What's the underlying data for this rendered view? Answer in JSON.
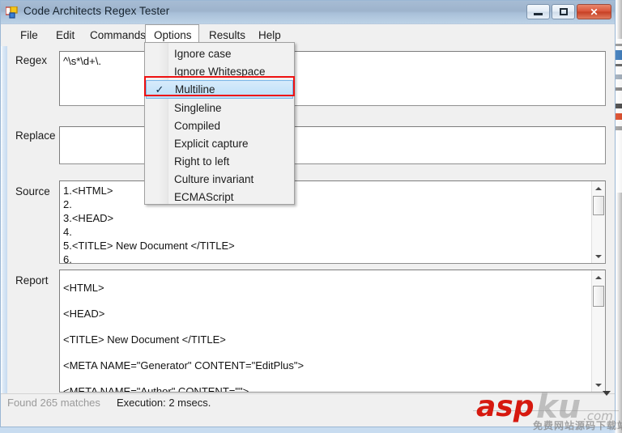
{
  "window": {
    "title": "Code Architects Regex Tester",
    "icon": "app-squares-icon",
    "buttons": {
      "minimize": "minimize-icon",
      "maximize": "maximize-icon",
      "close": "✕"
    }
  },
  "menubar": {
    "items": [
      {
        "label": "File",
        "open": false
      },
      {
        "label": "Edit",
        "open": false
      },
      {
        "label": "Commands",
        "open": false
      },
      {
        "label": "Options",
        "open": true
      },
      {
        "label": "Results",
        "open": false
      },
      {
        "label": "Help",
        "open": false
      }
    ]
  },
  "options_menu": {
    "items": [
      {
        "label": "Ignore case",
        "checked": false,
        "selected": false
      },
      {
        "label": "Ignore Whitespace",
        "checked": false,
        "selected": false
      },
      {
        "label": "Multiline",
        "checked": true,
        "selected": true
      },
      {
        "label": "Singleline",
        "checked": false,
        "selected": false
      },
      {
        "label": "Compiled",
        "checked": false,
        "selected": false
      },
      {
        "label": "Explicit capture",
        "checked": false,
        "selected": false
      },
      {
        "label": "Right to left",
        "checked": false,
        "selected": false
      },
      {
        "label": "Culture invariant",
        "checked": false,
        "selected": false
      },
      {
        "label": "ECMAScript",
        "checked": false,
        "selected": false
      }
    ],
    "check_glyph": "✓"
  },
  "fields": {
    "regex": {
      "label": "Regex",
      "value": "^\\s*\\d+\\."
    },
    "replace": {
      "label": "Replace",
      "value": ""
    },
    "source": {
      "label": "Source",
      "value": "1.<HTML>\n2.\n3.<HEAD>\n4.\n5.<TITLE> New Document </TITLE>\n6."
    },
    "report": {
      "label": "Report",
      "value": "<HTML>\n<HEAD>\n<TITLE> New Document </TITLE>\n<META NAME=\"Generator\" CONTENT=\"EditPlus\">\n<META NAME=\"Author\" CONTENT=\"\">"
    }
  },
  "statusbar": {
    "found": "Found 265 matches",
    "execution": "Execution: 2 msecs."
  },
  "watermark": {
    "brand_red": "asp",
    "brand_gray": "ku",
    "domain": ".com",
    "tagline": "免费网站源码下载站!"
  },
  "colors": {
    "titlebar_top": "#9db3cc",
    "titlebar_bottom": "#bcd2e6",
    "selection_blue": "#bcdff8",
    "annotation_red": "#ee1111",
    "close_button": "#d8543a",
    "brand_red": "#d6190f",
    "status_disabled": "#9a9a9a"
  }
}
